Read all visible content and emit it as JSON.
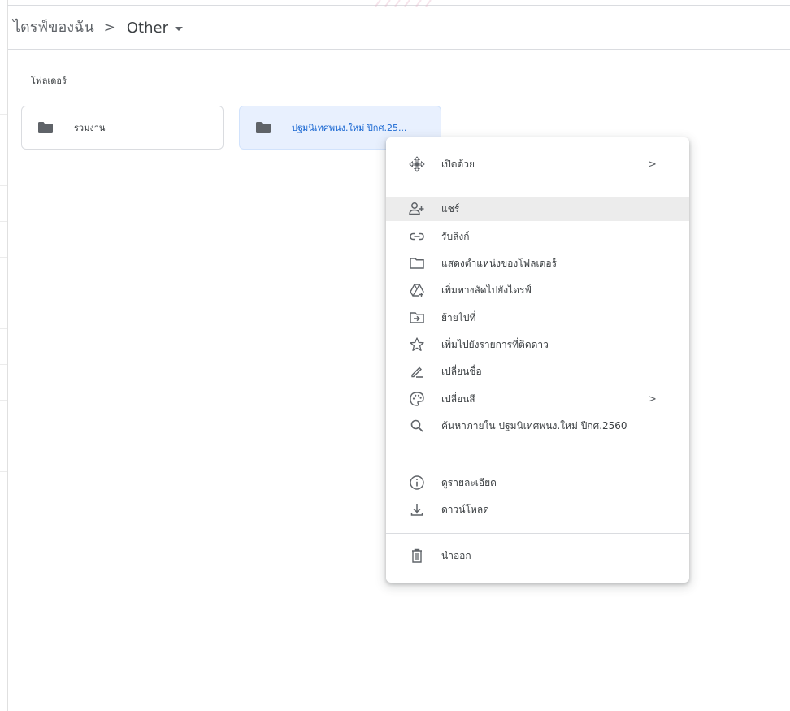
{
  "breadcrumb": {
    "root": "ไดรฟ์ของฉัน",
    "separator": ">",
    "current": "Other"
  },
  "folders_section": {
    "label": "โฟลเดอร์",
    "items": [
      {
        "name": "รวมงาน",
        "selected": false
      },
      {
        "name": "ปฐมนิเทศพนง.ใหม่ ปีกศ.25...",
        "selected": true
      }
    ]
  },
  "context_menu": {
    "open_with": "เปิดด้วย",
    "share": "แชร์",
    "get_link": "รับลิงก์",
    "show_location": "แสดงตำแหน่งของโฟลเดอร์",
    "add_shortcut": "เพิ่มทางลัดไปยังไดรฟ์",
    "move_to": "ย้ายไปที่",
    "add_starred": "เพิ่มไปยังรายการที่ติดดาว",
    "rename": "เปลี่ยนชื่อ",
    "change_color": "เปลี่ยนสี",
    "search_within": "ค้นหาภายใน ปฐมนิเทศพนง.ใหม่ ปีกศ.2560",
    "view_details": "ดูรายละเอียด",
    "download": "ดาวน์โหลด",
    "remove": "นำออก",
    "submenu_chevron": ">"
  },
  "colors": {
    "selected_bg": "#e8f0fe",
    "selected_text": "#1967d2",
    "hover_bg": "#ececec",
    "icon": "#5f6368"
  }
}
